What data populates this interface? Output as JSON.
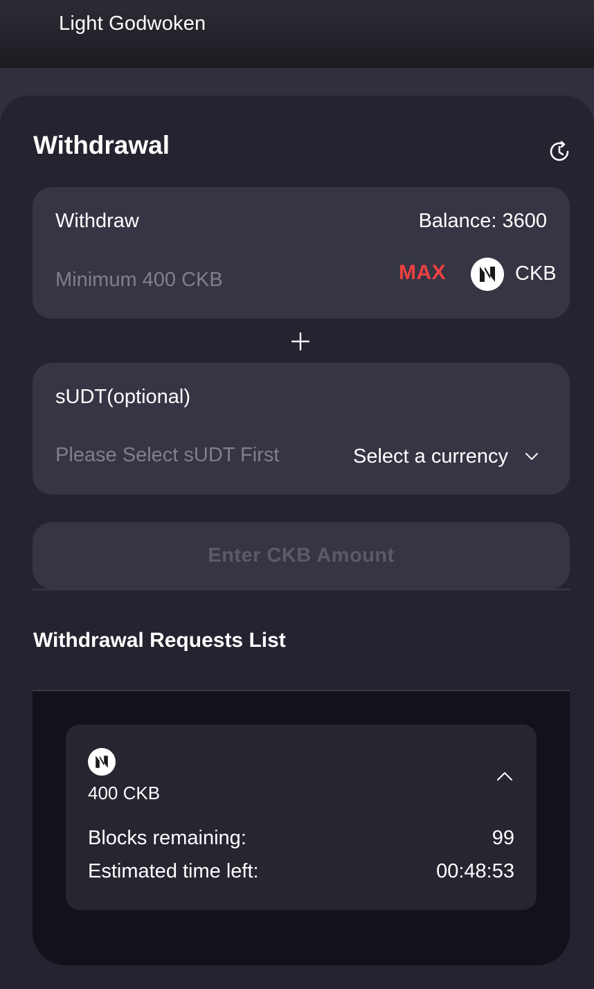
{
  "header": {
    "app_title": "Light Godwoken"
  },
  "withdrawal": {
    "title": "Withdrawal",
    "history_icon": "history-icon",
    "withdraw_card": {
      "label": "Withdraw",
      "balance": "Balance: 3600",
      "amount_value": "",
      "amount_placeholder": "Minimum 400 CKB",
      "max_label": "MAX",
      "token_icon": "nervos-logo-icon",
      "token_name": "CKB"
    },
    "plus_icon": "plus-icon",
    "sudt_card": {
      "label": "sUDT(optional)",
      "amount_placeholder": "Please Select sUDT First",
      "currency_select": "Select a currency",
      "chevron_icon": "chevron-down-icon"
    },
    "submit_button": "Enter CKB Amount"
  },
  "requests": {
    "title": "Withdrawal Requests List",
    "items": [
      {
        "token_icon": "nervos-logo-icon",
        "amount": "400 CKB",
        "expand_icon": "chevron-up-icon",
        "blocks_label": "Blocks remaining:",
        "blocks_value": "99",
        "time_label": "Estimated time left:",
        "time_value": "00:48:53"
      }
    ]
  },
  "colors": {
    "background": "#2f2f3d",
    "panel": "#24232f",
    "card": "#363544",
    "accent_max": "#f04040",
    "placeholder": "#807f8e",
    "list_bg": "#13121c"
  }
}
